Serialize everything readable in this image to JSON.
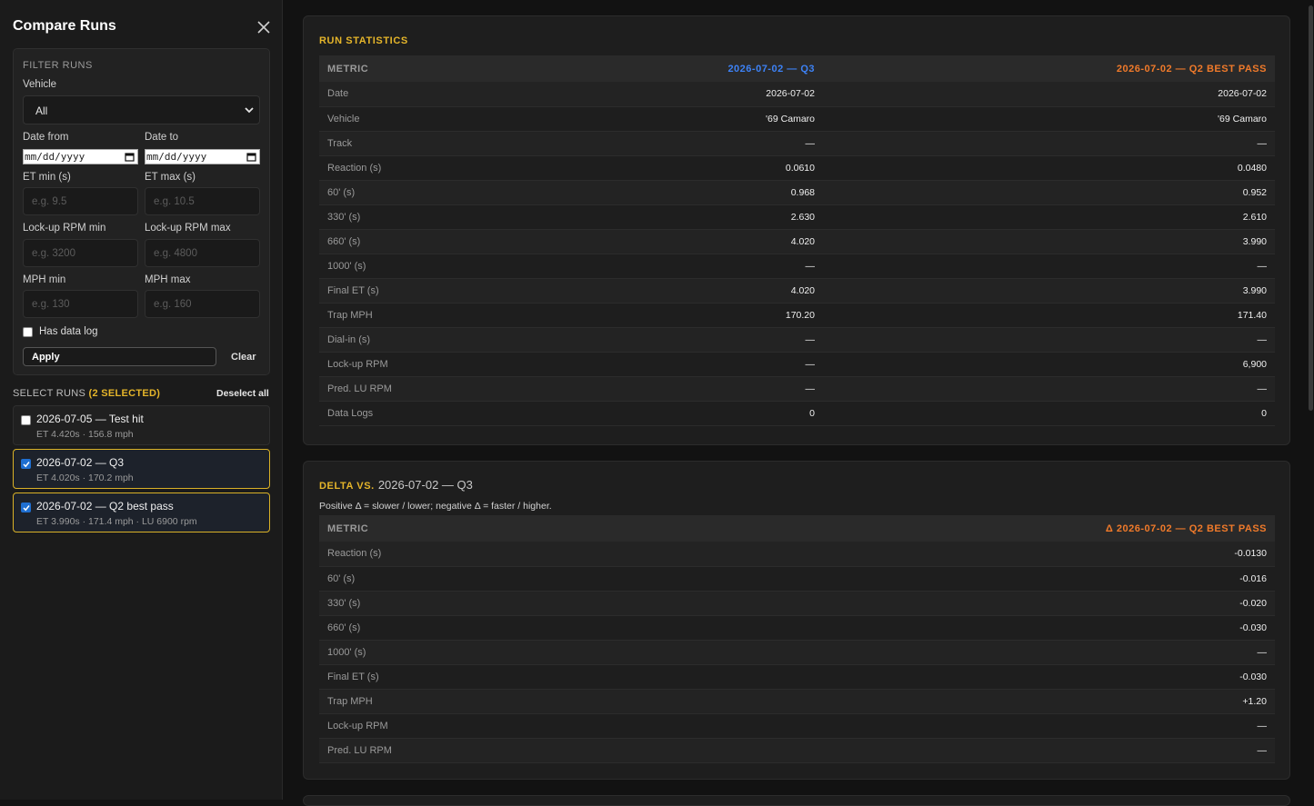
{
  "sidebar": {
    "title": "Compare Runs",
    "filter": {
      "heading": "FILTER RUNS",
      "vehicle_label": "Vehicle",
      "vehicle_value": "All",
      "date_from_label": "Date from",
      "date_to_label": "Date to",
      "date_placeholder": "mm/dd/yyyy",
      "et_min_label": "ET min (s)",
      "et_min_placeholder": "e.g. 9.5",
      "et_max_label": "ET max (s)",
      "et_max_placeholder": "e.g. 10.5",
      "rpm_min_label": "Lock-up RPM min",
      "rpm_min_placeholder": "e.g. 3200",
      "rpm_max_label": "Lock-up RPM max",
      "rpm_max_placeholder": "e.g. 4800",
      "mph_min_label": "MPH min",
      "mph_min_placeholder": "e.g. 130",
      "mph_max_label": "MPH max",
      "mph_max_placeholder": "e.g. 160",
      "has_log_label": "Has data log",
      "apply_label": "Apply",
      "clear_label": "Clear"
    },
    "select_heading": "SELECT RUNS",
    "selected_count": "(2 SELECTED)",
    "deselect_label": "Deselect all",
    "runs": [
      {
        "title": "2026-07-05 — Test hit",
        "sub": "ET 4.420s · 156.8 mph",
        "checked": false
      },
      {
        "title": "2026-07-02 — Q3",
        "sub": "ET 4.020s · 170.2 mph",
        "checked": true
      },
      {
        "title": "2026-07-02 — Q2 best pass",
        "sub": "ET 3.990s · 171.4 mph · LU 6900 rpm",
        "checked": true
      }
    ]
  },
  "stats": {
    "title": "RUN STATISTICS",
    "col_metric": "METRIC",
    "col_a": "2026-07-02 — Q3",
    "col_b": "2026-07-02 — Q2 BEST PASS",
    "rows": [
      {
        "metric": "Date",
        "a": "2026-07-02",
        "b": "2026-07-02"
      },
      {
        "metric": "Vehicle",
        "a": "'69 Camaro",
        "b": "'69 Camaro"
      },
      {
        "metric": "Track",
        "a": "—",
        "b": "—"
      },
      {
        "metric": "Reaction (s)",
        "a": "0.0610",
        "b": "0.0480"
      },
      {
        "metric": "60' (s)",
        "a": "0.968",
        "b": "0.952"
      },
      {
        "metric": "330' (s)",
        "a": "2.630",
        "b": "2.610"
      },
      {
        "metric": "660' (s)",
        "a": "4.020",
        "b": "3.990"
      },
      {
        "metric": "1000' (s)",
        "a": "—",
        "b": "—"
      },
      {
        "metric": "Final ET (s)",
        "a": "4.020",
        "b": "3.990"
      },
      {
        "metric": "Trap MPH",
        "a": "170.20",
        "b": "171.40"
      },
      {
        "metric": "Dial-in (s)",
        "a": "—",
        "b": "—"
      },
      {
        "metric": "Lock-up RPM",
        "a": "—",
        "b": "6,900"
      },
      {
        "metric": "Pred. LU RPM",
        "a": "—",
        "b": "—"
      },
      {
        "metric": "Data Logs",
        "a": "0",
        "b": "0"
      }
    ]
  },
  "delta": {
    "title_key": "DELTA VS.",
    "title_ref": "2026-07-02 — Q3",
    "note": "Positive Δ = slower / lower; negative Δ = faster / higher.",
    "col_metric": "METRIC",
    "col_b": "Δ 2026-07-02 — Q2 BEST PASS",
    "rows": [
      {
        "metric": "Reaction (s)",
        "value": "-0.0130"
      },
      {
        "metric": "60' (s)",
        "value": "-0.016"
      },
      {
        "metric": "330' (s)",
        "value": "-0.020"
      },
      {
        "metric": "660' (s)",
        "value": "-0.030"
      },
      {
        "metric": "1000' (s)",
        "value": "—"
      },
      {
        "metric": "Final ET (s)",
        "value": "-0.030"
      },
      {
        "metric": "Trap MPH",
        "value": "+1.20"
      },
      {
        "metric": "Lock-up RPM",
        "value": "—"
      },
      {
        "metric": "Pred. LU RPM",
        "value": "—"
      }
    ]
  },
  "colors": {
    "accent": "#e5b52a",
    "run_a": "#3d82f6",
    "run_b": "#f07a2a",
    "better": "#2fc25b"
  }
}
